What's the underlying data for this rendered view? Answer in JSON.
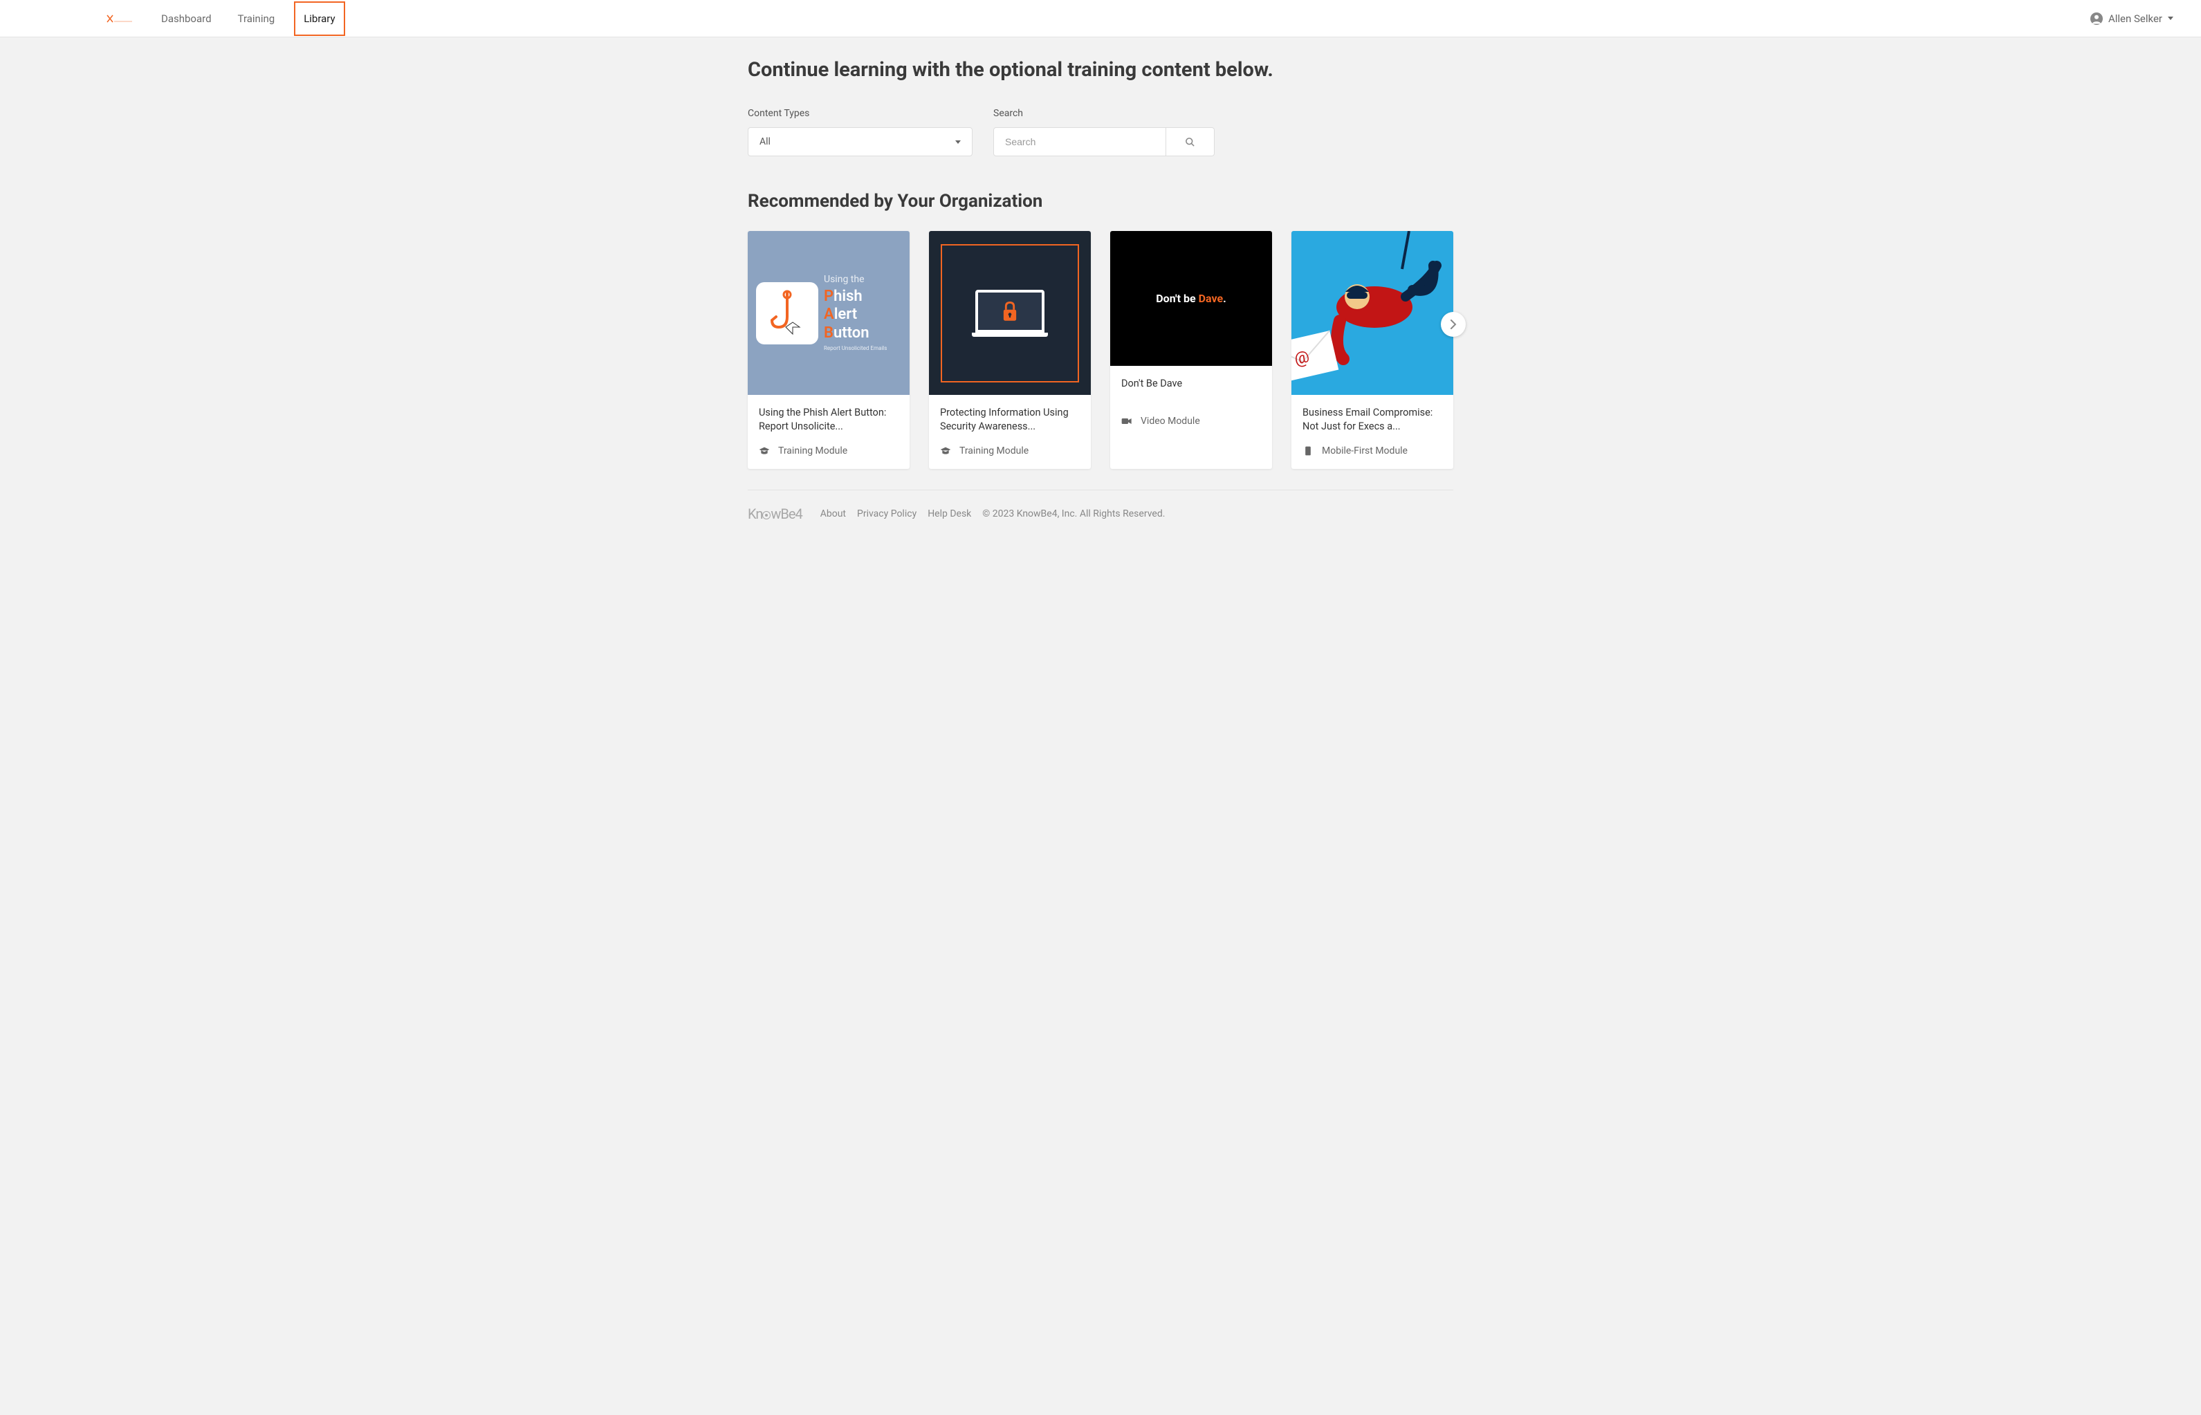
{
  "nav": {
    "items": [
      "Dashboard",
      "Training",
      "Library"
    ],
    "active_index": 2
  },
  "user": {
    "name": "Allen Selker"
  },
  "page": {
    "title": "Continue learning with the optional training content below."
  },
  "filters": {
    "content_types": {
      "label": "Content Types",
      "selected": "All"
    },
    "search": {
      "label": "Search",
      "placeholder": "Search",
      "value": ""
    }
  },
  "section": {
    "recommended_title": "Recommended by Your Organization"
  },
  "cards": [
    {
      "title": "Using the Phish Alert Button: Report Unsolicite...",
      "type_label": "Training Module",
      "type_icon": "graduation-cap-icon",
      "thumb": {
        "kind": "pab",
        "using": "Using the",
        "line1_letter": "P",
        "line1_rest": "hish",
        "line2_letter": "A",
        "line2_rest": "lert",
        "line3_letter": "B",
        "line3_rest": "utton",
        "sub": "Report Unsolicited Emails"
      }
    },
    {
      "title": "Protecting Information Using Security Awareness...",
      "type_label": "Training Module",
      "type_icon": "graduation-cap-icon",
      "thumb": {
        "kind": "laptop-lock"
      }
    },
    {
      "title": "Don't Be Dave",
      "type_label": "Video Module",
      "type_icon": "video-icon",
      "thumb": {
        "kind": "dont-be-dave",
        "prefix": "Don't be ",
        "accent": "Dave",
        "suffix": "."
      }
    },
    {
      "title": "Business Email Compromise: Not Just for Execs a...",
      "type_label": "Mobile-First Module",
      "type_icon": "mobile-icon",
      "thumb": {
        "kind": "email-thief"
      }
    }
  ],
  "footer": {
    "brand": "KnowBe4",
    "links": [
      "About",
      "Privacy Policy",
      "Help Desk"
    ],
    "copyright": "© 2023 KnowBe4, Inc. All Rights Reserved."
  }
}
